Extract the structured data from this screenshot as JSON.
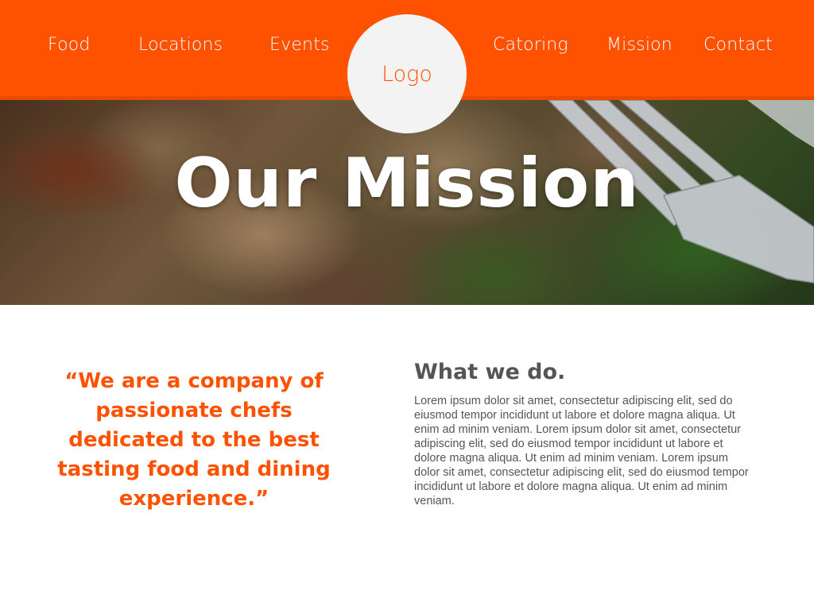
{
  "nav": {
    "left_items": [
      {
        "label": "Food"
      },
      {
        "label": "Locations"
      },
      {
        "label": "Events"
      }
    ],
    "right_items": [
      {
        "label": "Catoring"
      },
      {
        "label": "Mission"
      },
      {
        "label": "Contact"
      }
    ],
    "logo_text": "Logo"
  },
  "hero": {
    "title": "Our Mission"
  },
  "quote": {
    "text": "“We are a company of passionate chefs dedicated to the best tasting food and dining experience.”"
  },
  "what_we_do": {
    "heading": "What we do.",
    "body": "Lorem ipsum dolor sit amet, consectetur adipiscing elit, sed do eiusmod tempor incididunt ut labore et dolore magna aliqua. Ut enim ad minim veniam. Lorem ipsum dolor sit amet, consectetur adipiscing elit, sed do eiusmod tempor incididunt ut labore et dolore magna aliqua. Ut enim ad minim veniam. Lorem ipsum dolor sit amet, consectetur adipiscing elit, sed do eiusmod tempor incididunt ut labore et dolore magna aliqua. Ut enim ad minim veniam."
  },
  "colors": {
    "brand_orange": "#ff5200",
    "logo_bg": "#f3f3f3",
    "text_gray": "#555555"
  }
}
